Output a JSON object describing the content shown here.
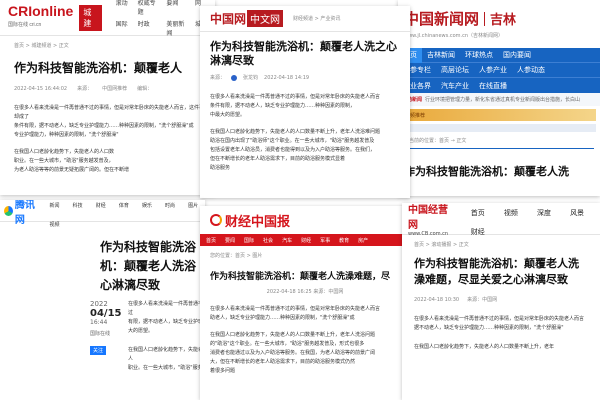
{
  "panel1": {
    "logo": "CRIonline",
    "logo_sub": "国际在线 cri.cn",
    "tag": "城建",
    "nav": [
      "滚动",
      "权威专题",
      "要闻",
      "网",
      "国际",
      "时政",
      "美丽新闻",
      "城建",
      "城",
      "城市"
    ],
    "breadcrumb": "首页 > 城建频道 > 正文",
    "title": "作为科技智能洗浴机：颠覆老人",
    "date": "2022-04-15 16:44:02",
    "source": "来源：",
    "source2": "中国网推荐",
    "editor": "编辑：",
    "p1": "在很多人看来洗澡是一件再普通不过的事情，但是对常年卧床的失能老人而言，这件事却成了",
    "p2": "条件有限，据不动老人，缺乏专业护理能力……种种因素的限制，\"洗个舒服澡\"成",
    "p3": "专业护理能力，种种因素的限制，\"洗个舒服澡\"",
    "p4": "在我国人口老龄化趋势下，失能老人的人口数",
    "p5": "职业。在一些大城市，\"助浴\"服务越发普及，",
    "p6": "为老人助浴等等的前景无疑拓展广阔的。但在不断增"
  },
  "panel2": {
    "logo1": "中国网",
    "logo2": "中文网",
    "nav": "财经频道 > 产业资讯",
    "title": "作为科技智能洗浴机：颠覆老人洗之心淋漓尽致",
    "meta": "来源：",
    "author": "张龙钧",
    "date": "2022-04-18 14:19",
    "p1": "在很多人看来洗澡是一件再普通不过的事情，但是对常年卧床的失能老人而言",
    "p2": "条件有限，据不动老人，缺乏专业护理能力……种种因素的限制，",
    "p3": "中最大的愿望。",
    "p4": "在我国人口老龄化趋势下，失能老人的人口数量不断上升，老年人洗浴难问题",
    "p5": "助浴在国内出现了\"助浴师\"这个职业。在一些大城市，\"助浴\"服务越发普及",
    "p6": "包括设置老年人助浴员，消费者也能得到以及为入户助浴等服务。在我们，",
    "p7": "但在不断增长的老年人助浴需求下，目前的助浴服务模式显着",
    "p8": "助浴服务"
  },
  "panel3": {
    "logo1": "中国新闻网",
    "logo2": "吉林",
    "url": "www.jl.chinanews.com.cn（吉林新闻网）",
    "nav_row1": [
      "首页",
      "吉林新闻",
      "环球热点",
      "国内要闻"
    ],
    "nav_row2": [
      "人参专栏",
      "高层论坛",
      "人参产业",
      "人参动态"
    ],
    "nav_row3": [
      "行业各界",
      "汽车产业",
      "在线直播"
    ],
    "ticker_label": "滚动新闻",
    "ticker": "行业环境把管理力量，新化东省通过真机专业新闻版出台措施，长白山",
    "banner": "视频推荐",
    "loc": "您当前的位置：首页 → 正文",
    "title": "作为科技智能洗浴机：颠覆老人洗"
  },
  "panel4": {
    "logo": "腾讯网",
    "nav": [
      "新闻",
      "科技",
      "财经",
      "体育",
      "娱乐",
      "时尚",
      "图片",
      "视频"
    ],
    "title": "作为科技智能洗浴机：颠覆老人洗浴心淋漓尽致",
    "date_big": "2022",
    "date_md": "04/15",
    "date_time": "16:44",
    "source": "国际在线",
    "follow": "关注",
    "p1": "在很多人看来洗澡是一件再普通不过",
    "p2": "有限，据不动老人，缺乏专业护理",
    "p3": "大的愿望。",
    "p4": "在我国人口老龄化趋势下，失能老人",
    "p5": "职业。在一些大城市，\"助浴\"服务"
  },
  "panel5": {
    "logo": "财经中国报",
    "nav": [
      "首页",
      "要闻",
      "国际",
      "社会",
      "汽车",
      "财经",
      "军事",
      "教育",
      "房产"
    ],
    "crumb": "您的位置：首页 > 图片",
    "title": "作为科技智能洗浴机：颠覆老人洗澡难题，尽",
    "meta": "2022-04-18   16:25   来源：中国网",
    "p1": "在很多人看来洗澡是一件再普通不过的事情，但是对常年卧床的失能老人而言",
    "p2": "助老人，缺乏专业护理能力……种种因素的限制，\"洗个舒服澡\"成",
    "p3": "在我国人口老龄化趋势下，失能老人的人口数量不断上升，老年人洗浴问题",
    "p4": "的\"助浴\"这个职业。在一些大城市，\"助浴\"服务越发普及，形式也很多",
    "p5": "消费者也能通过以及为入户助浴等服务。在我国，为老人助浴等的前景广阔",
    "p6": "大，但在不断增长的老年人助浴需求下，目前的助浴服务模式仍然",
    "p7": "着很多问题"
  },
  "panel6": {
    "logo": "中国经营网",
    "logo_sub": "www.CB.com.cn",
    "nav": [
      "首页",
      "视频",
      "深度",
      "风景",
      "财经"
    ],
    "crumb": "首页 > 滚动播报 > 正文",
    "title": "作为科技智能洗浴机：颠覆老人洗澡难题，尽显关爱之心淋漓尽致",
    "date": "2022-04-18 10:30",
    "source": "来源：中国网",
    "p1": "在很多人看来洗澡是一件再普通不过的事情，但是对常年卧床的失能老人而言",
    "p2": "据不动老人，缺乏专业护理能力……种种因素的限制，\"洗个舒服澡\"",
    "p3": "",
    "p4": "在我国人口老龄化趋势下，失能老人的人口数量不断上升，老年"
  }
}
